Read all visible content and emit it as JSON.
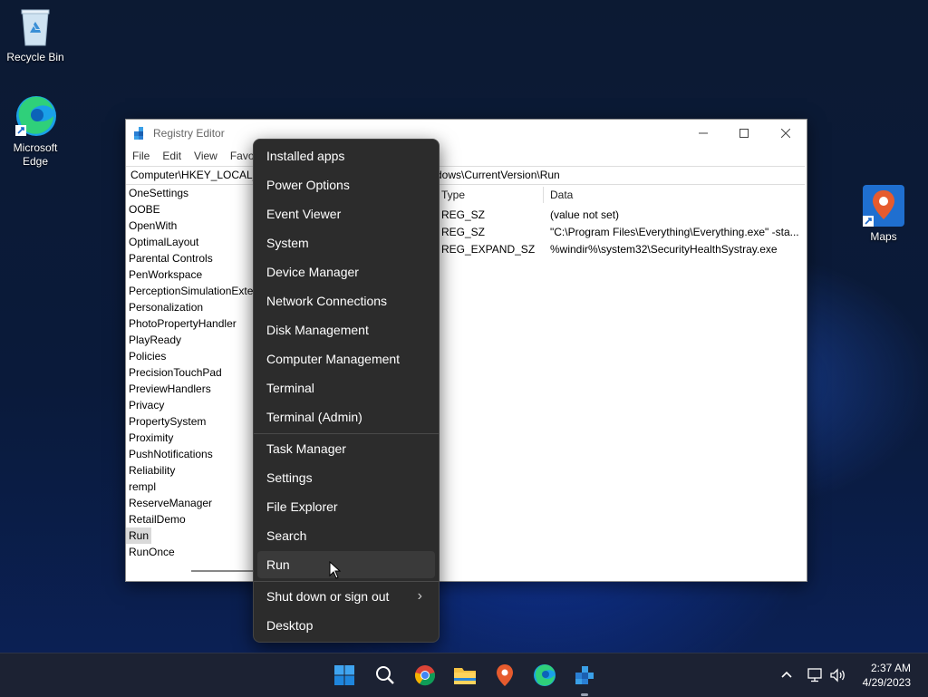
{
  "desktop": {
    "icons": [
      {
        "label": "Recycle Bin"
      },
      {
        "label": "Microsoft Edge"
      },
      {
        "label": "Maps"
      }
    ]
  },
  "registry": {
    "title": "Registry Editor",
    "menu": [
      "File",
      "Edit",
      "View",
      "Favor"
    ],
    "address_left": "Computer\\HKEY_LOCAL_",
    "address_right": "dows\\CurrentVersion\\Run",
    "tree": [
      "OneSettings",
      "OOBE",
      "OpenWith",
      "OptimalLayout",
      "Parental Controls",
      "PenWorkspace",
      "PerceptionSimulationExte",
      "Personalization",
      "PhotoPropertyHandler",
      "PlayReady",
      "Policies",
      "PrecisionTouchPad",
      "PreviewHandlers",
      "Privacy",
      "PropertySystem",
      "Proximity",
      "PushNotifications",
      "Reliability",
      "rempl",
      "ReserveManager",
      "RetailDemo",
      "Run",
      "RunOnce"
    ],
    "selected_tree_item": "Run",
    "columns": {
      "type": "Type",
      "data": "Data"
    },
    "rows": [
      {
        "type": "REG_SZ",
        "data": "(value not set)"
      },
      {
        "type": "REG_SZ",
        "data": "\"C:\\Program Files\\Everything\\Everything.exe\" -sta..."
      },
      {
        "type": "REG_EXPAND_SZ",
        "data": "%windir%\\system32\\SecurityHealthSystray.exe"
      }
    ]
  },
  "context_menu": {
    "group1": [
      "Installed apps",
      "Power Options",
      "Event Viewer",
      "System",
      "Device Manager",
      "Network Connections",
      "Disk Management",
      "Computer Management",
      "Terminal",
      "Terminal (Admin)"
    ],
    "group2": [
      "Task Manager",
      "Settings",
      "File Explorer",
      "Search",
      "Run"
    ],
    "hovered": "Run",
    "shutdown": "Shut down or sign out",
    "desktop": "Desktop"
  },
  "taskbar": {
    "time": "2:37 AM",
    "date": "4/29/2023",
    "pinned": [
      "start-icon",
      "search-icon",
      "chrome-icon",
      "file-explorer-icon",
      "maps-icon",
      "edge-icon",
      "registry-editor-icon"
    ]
  },
  "colors": {
    "menu_bg": "#2c2c2c",
    "menu_hover": "#3a3a3a",
    "taskbar_bg": "#1c2233",
    "accent": "#0078d4"
  }
}
